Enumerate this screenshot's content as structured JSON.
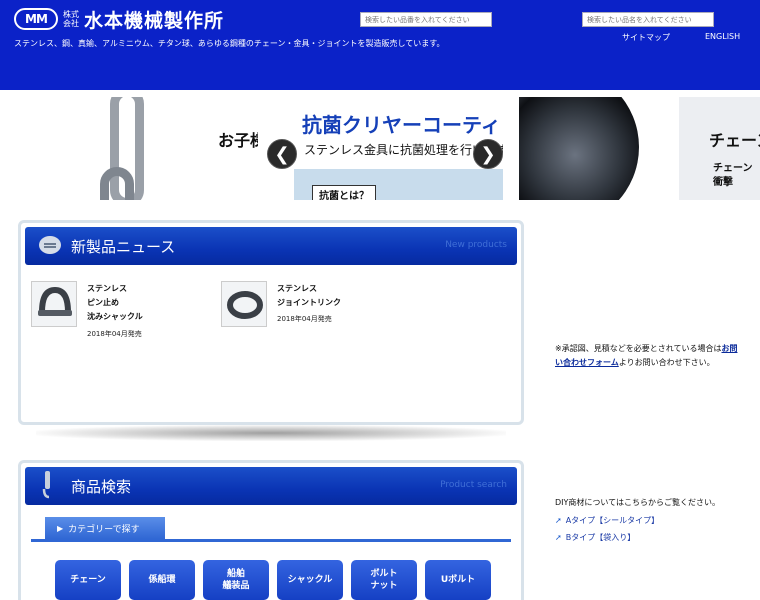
{
  "header": {
    "logo_badge": "MM",
    "logo_kabu": "株式会社",
    "company_name": "水本機械製作所",
    "tagline": "ステンレス、鋼、真鍮、アルミニウム、チタン球、あらゆる鋼種のチェーン・金具・ジョイントを製造販売しています。",
    "search1_placeholder": "検索したい品番を入れてください",
    "search2_placeholder": "検索したい品名を入れてください",
    "sitemap": "サイトマップ",
    "english": "ENGLISH"
  },
  "banners": {
    "b1_text": "お子様",
    "b2_title": "抗菌クリヤーコーティング",
    "b2_sub": "ステンレス金具に抗菌処理を行います",
    "b2_button": "抗菌とは？",
    "b3_t1": "チェーン",
    "b3_t2": "チェーン",
    "b3_t3": "衝撃",
    "prev": "❮",
    "next": "❯"
  },
  "news": {
    "title": "新製品ニュース",
    "title_en": "New products",
    "items": [
      {
        "name": "ステンレス\nピン止め\n沈みシャックル",
        "date": "2018年04月発売"
      },
      {
        "name": "ステンレス\nジョイントリンク",
        "date": "2018年04月発売"
      }
    ]
  },
  "product_search": {
    "title": "商品検索",
    "title_en": "Product search",
    "tab": "カテゴリーで探す",
    "categories": [
      "チェーン",
      "係船環",
      "船舶\n艤装品",
      "シャックル",
      "ボルト\nナット",
      "Uボルト"
    ]
  },
  "side": {
    "note_pre": "※承認図、見積などを必要とされている場合は",
    "note_link": "お問い合わせフォーム",
    "note_post": "よりお問い合わせ下さい。",
    "diy_head": "DIY商材についてはこちらからご覧ください。",
    "diy_a": "Aタイプ【シールタイプ】",
    "diy_b": "Bタイプ【袋入り】"
  },
  "colors": {
    "header_bg": "#0b22c8",
    "panel_head": "#0a34b4",
    "accent": "#3067d4"
  }
}
